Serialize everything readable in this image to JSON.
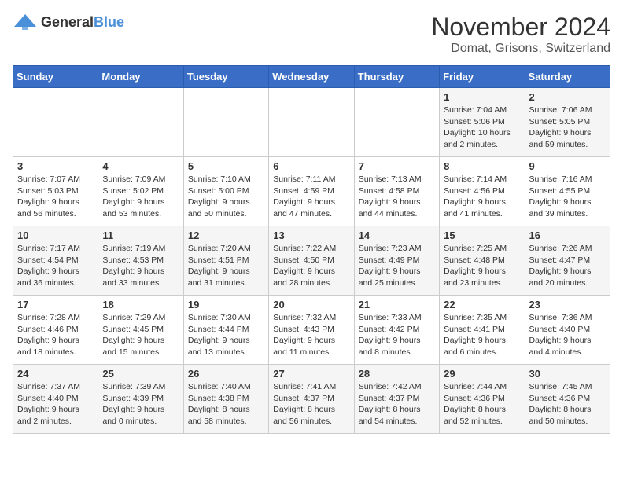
{
  "logo": {
    "text_general": "General",
    "text_blue": "Blue"
  },
  "title": "November 2024",
  "subtitle": "Domat, Grisons, Switzerland",
  "headers": [
    "Sunday",
    "Monday",
    "Tuesday",
    "Wednesday",
    "Thursday",
    "Friday",
    "Saturday"
  ],
  "rows": [
    [
      {
        "day": "",
        "info": ""
      },
      {
        "day": "",
        "info": ""
      },
      {
        "day": "",
        "info": ""
      },
      {
        "day": "",
        "info": ""
      },
      {
        "day": "",
        "info": ""
      },
      {
        "day": "1",
        "info": "Sunrise: 7:04 AM\nSunset: 5:06 PM\nDaylight: 10 hours\nand 2 minutes."
      },
      {
        "day": "2",
        "info": "Sunrise: 7:06 AM\nSunset: 5:05 PM\nDaylight: 9 hours\nand 59 minutes."
      }
    ],
    [
      {
        "day": "3",
        "info": "Sunrise: 7:07 AM\nSunset: 5:03 PM\nDaylight: 9 hours\nand 56 minutes."
      },
      {
        "day": "4",
        "info": "Sunrise: 7:09 AM\nSunset: 5:02 PM\nDaylight: 9 hours\nand 53 minutes."
      },
      {
        "day": "5",
        "info": "Sunrise: 7:10 AM\nSunset: 5:00 PM\nDaylight: 9 hours\nand 50 minutes."
      },
      {
        "day": "6",
        "info": "Sunrise: 7:11 AM\nSunset: 4:59 PM\nDaylight: 9 hours\nand 47 minutes."
      },
      {
        "day": "7",
        "info": "Sunrise: 7:13 AM\nSunset: 4:58 PM\nDaylight: 9 hours\nand 44 minutes."
      },
      {
        "day": "8",
        "info": "Sunrise: 7:14 AM\nSunset: 4:56 PM\nDaylight: 9 hours\nand 41 minutes."
      },
      {
        "day": "9",
        "info": "Sunrise: 7:16 AM\nSunset: 4:55 PM\nDaylight: 9 hours\nand 39 minutes."
      }
    ],
    [
      {
        "day": "10",
        "info": "Sunrise: 7:17 AM\nSunset: 4:54 PM\nDaylight: 9 hours\nand 36 minutes."
      },
      {
        "day": "11",
        "info": "Sunrise: 7:19 AM\nSunset: 4:53 PM\nDaylight: 9 hours\nand 33 minutes."
      },
      {
        "day": "12",
        "info": "Sunrise: 7:20 AM\nSunset: 4:51 PM\nDaylight: 9 hours\nand 31 minutes."
      },
      {
        "day": "13",
        "info": "Sunrise: 7:22 AM\nSunset: 4:50 PM\nDaylight: 9 hours\nand 28 minutes."
      },
      {
        "day": "14",
        "info": "Sunrise: 7:23 AM\nSunset: 4:49 PM\nDaylight: 9 hours\nand 25 minutes."
      },
      {
        "day": "15",
        "info": "Sunrise: 7:25 AM\nSunset: 4:48 PM\nDaylight: 9 hours\nand 23 minutes."
      },
      {
        "day": "16",
        "info": "Sunrise: 7:26 AM\nSunset: 4:47 PM\nDaylight: 9 hours\nand 20 minutes."
      }
    ],
    [
      {
        "day": "17",
        "info": "Sunrise: 7:28 AM\nSunset: 4:46 PM\nDaylight: 9 hours\nand 18 minutes."
      },
      {
        "day": "18",
        "info": "Sunrise: 7:29 AM\nSunset: 4:45 PM\nDaylight: 9 hours\nand 15 minutes."
      },
      {
        "day": "19",
        "info": "Sunrise: 7:30 AM\nSunset: 4:44 PM\nDaylight: 9 hours\nand 13 minutes."
      },
      {
        "day": "20",
        "info": "Sunrise: 7:32 AM\nSunset: 4:43 PM\nDaylight: 9 hours\nand 11 minutes."
      },
      {
        "day": "21",
        "info": "Sunrise: 7:33 AM\nSunset: 4:42 PM\nDaylight: 9 hours\nand 8 minutes."
      },
      {
        "day": "22",
        "info": "Sunrise: 7:35 AM\nSunset: 4:41 PM\nDaylight: 9 hours\nand 6 minutes."
      },
      {
        "day": "23",
        "info": "Sunrise: 7:36 AM\nSunset: 4:40 PM\nDaylight: 9 hours\nand 4 minutes."
      }
    ],
    [
      {
        "day": "24",
        "info": "Sunrise: 7:37 AM\nSunset: 4:40 PM\nDaylight: 9 hours\nand 2 minutes."
      },
      {
        "day": "25",
        "info": "Sunrise: 7:39 AM\nSunset: 4:39 PM\nDaylight: 9 hours\nand 0 minutes."
      },
      {
        "day": "26",
        "info": "Sunrise: 7:40 AM\nSunset: 4:38 PM\nDaylight: 8 hours\nand 58 minutes."
      },
      {
        "day": "27",
        "info": "Sunrise: 7:41 AM\nSunset: 4:37 PM\nDaylight: 8 hours\nand 56 minutes."
      },
      {
        "day": "28",
        "info": "Sunrise: 7:42 AM\nSunset: 4:37 PM\nDaylight: 8 hours\nand 54 minutes."
      },
      {
        "day": "29",
        "info": "Sunrise: 7:44 AM\nSunset: 4:36 PM\nDaylight: 8 hours\nand 52 minutes."
      },
      {
        "day": "30",
        "info": "Sunrise: 7:45 AM\nSunset: 4:36 PM\nDaylight: 8 hours\nand 50 minutes."
      }
    ]
  ]
}
